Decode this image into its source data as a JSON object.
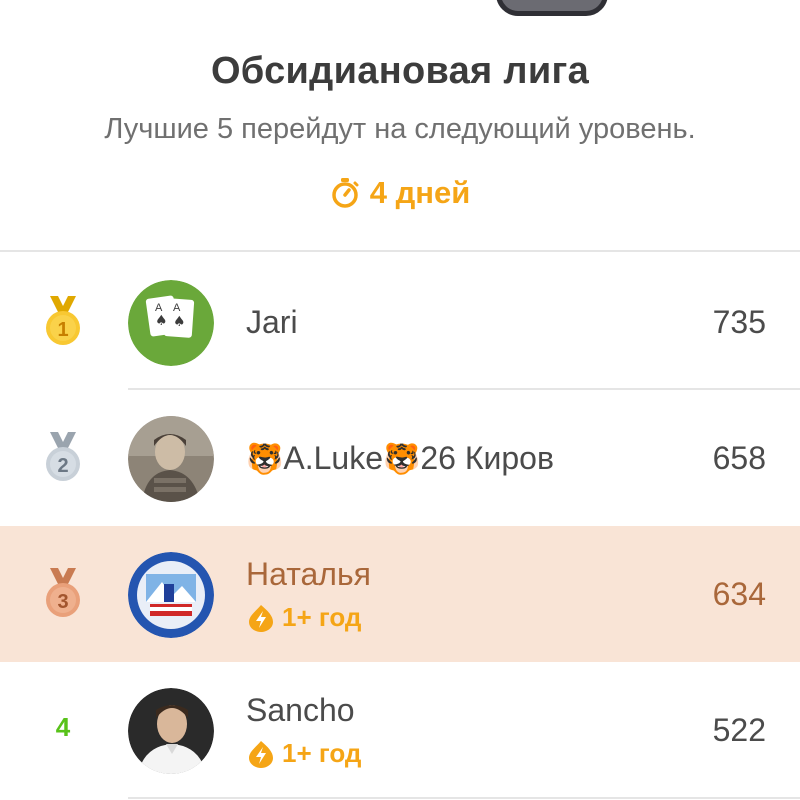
{
  "league": {
    "title": "Обсидиановая лига",
    "subtitle": "Лучшие 5 перейдут на следующий уровень.",
    "timer": "4 дней"
  },
  "colors": {
    "accent_orange": "#f5a516",
    "gold_medal": "#f8c832",
    "silver_medal": "#c8d0d8",
    "bronze_medal": "#e9a07a",
    "highlight_row": "#f9e4d6",
    "rank_green": "#58c21a"
  },
  "leaderboard": [
    {
      "rank": "1",
      "medal": "gold-medal-icon",
      "name": "Jari",
      "xp": "735",
      "streak": ""
    },
    {
      "rank": "2",
      "medal": "silver-medal-icon",
      "name_prefix": "🐯",
      "name_mid": "A.Luke",
      "name_tiger": "🐯",
      "name_suffix": "26 Киров",
      "xp": "658",
      "streak": ""
    },
    {
      "rank": "3",
      "medal": "bronze-medal-icon",
      "name": "Наталья",
      "xp": "634",
      "streak": "1+ год"
    },
    {
      "rank": "4",
      "medal": "",
      "name": "Sancho",
      "xp": "522",
      "streak": "1+ год"
    }
  ]
}
